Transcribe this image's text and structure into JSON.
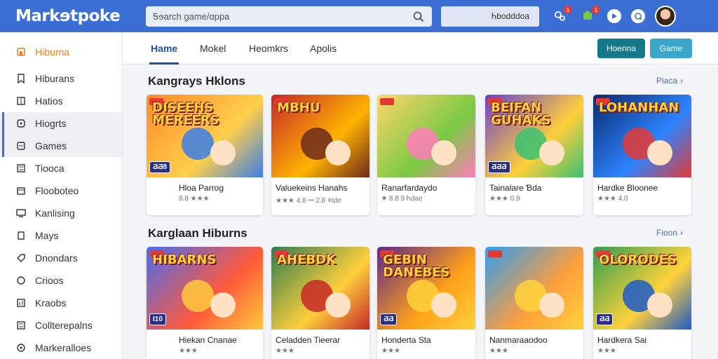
{
  "app": {
    "logo": "Markɘtpoke",
    "search_placeholder": "Ꭶɘarch ɡame/ɑppa",
    "filter_label": "Ꮒbodddoa",
    "notif_badge": "1",
    "cart_badge": "1"
  },
  "sidebar": {
    "items": [
      {
        "label": "Hiburna",
        "icon": "home-icon",
        "state": "active"
      },
      {
        "label": "Hiburans",
        "icon": "bookmark-icon",
        "state": ""
      },
      {
        "label": "Hatios",
        "icon": "grid-icon",
        "state": ""
      },
      {
        "label": "Hiogrts",
        "icon": "clock-icon",
        "state": "highlight"
      },
      {
        "label": "Games",
        "icon": "gamepad-icon",
        "state": "highlight"
      },
      {
        "label": "Tiooca",
        "icon": "list-icon",
        "state": ""
      },
      {
        "label": "Flooboteo",
        "icon": "calendar-icon",
        "state": ""
      },
      {
        "label": "Kanlising",
        "icon": "monitor-icon",
        "state": ""
      },
      {
        "label": "Mays",
        "icon": "map-icon",
        "state": ""
      },
      {
        "label": "Dnondars",
        "icon": "tag-icon",
        "state": ""
      },
      {
        "label": "Crioos",
        "icon": "circle-icon",
        "state": ""
      },
      {
        "label": "Kraobs",
        "icon": "chart-icon",
        "state": ""
      },
      {
        "label": "Collterepalns",
        "icon": "list-icon",
        "state": ""
      },
      {
        "label": "Markeralloes",
        "icon": "settings-icon",
        "state": ""
      }
    ]
  },
  "tabs": [
    "Hame",
    "Mokel",
    "Heomkrs",
    "Apolis"
  ],
  "actions": {
    "primary": "Hoenna",
    "secondary": "Game"
  },
  "sections": [
    {
      "title": "Kangrays Hklons",
      "see_all": "Piaca",
      "cards": [
        {
          "banner": "DISEEHS MEREERS",
          "badge": "ƋƋ8",
          "title": "Hloa Parrog",
          "sub": "8.8 ★★★",
          "palette": [
            "#ff8a2b",
            "#ffcf4a",
            "#3a7ee8"
          ]
        },
        {
          "banner": "MBHU",
          "badge": "",
          "title": "Valuekeins Hanahs",
          "sub": "★★★ 4.8 ꟷ 2.8 ǂtde",
          "palette": [
            "#c62828",
            "#ffb300",
            "#6d2a1c"
          ]
        },
        {
          "banner": "",
          "badge": "",
          "title": "Ranarfardaydo",
          "sub": "★ 8.8 9 Ꮒdae",
          "palette": [
            "#ffd66b",
            "#7ac943",
            "#ff7cbb"
          ]
        },
        {
          "banner": "BEIFAN GUHAKS",
          "badge": "ƋƋƋ",
          "title": "Tainalare Ɓda",
          "sub": "★★★ 0.9",
          "palette": [
            "#6a3fd0",
            "#ffcf3a",
            "#38c172"
          ]
        },
        {
          "banner": "LOHANHAN",
          "badge": "",
          "title": "Hardke Bloonee",
          "sub": "★★★ 4.0",
          "palette": [
            "#0b2a6f",
            "#2d84ff",
            "#e53935"
          ]
        }
      ]
    },
    {
      "title": "Karglaan Hiburns",
      "see_all": "Fioon",
      "cards": [
        {
          "banner": "HIBARNS",
          "badge": "Ɩ10",
          "title": "Hiekan Cnanae",
          "sub": "★★★",
          "palette": [
            "#4a6cf0",
            "#ff5a3a",
            "#ffc93c"
          ]
        },
        {
          "banner": "AHEBDK",
          "badge": "",
          "title": "Celadden Tieerar",
          "sub": "★★★",
          "palette": [
            "#2e7d4f",
            "#ffcf3a",
            "#c62828"
          ]
        },
        {
          "banner": "GEBIN DANEBES",
          "badge": "ƋƋ",
          "title": "Honderta Sta",
          "sub": "★★★",
          "palette": [
            "#5b2a86",
            "#ff9f1a",
            "#ffd23a"
          ]
        },
        {
          "banner": "",
          "badge": "",
          "title": "Nanmaraaodoo",
          "sub": "★★★",
          "palette": [
            "#2f9df0",
            "#ff9f3a",
            "#ffd23a"
          ]
        },
        {
          "banner": "OLORODES",
          "badge": "ƋƋ",
          "title": "Hardkera Sai",
          "sub": "★★★",
          "palette": [
            "#2e9e4f",
            "#ffd23a",
            "#1e5ac8"
          ]
        }
      ]
    }
  ]
}
